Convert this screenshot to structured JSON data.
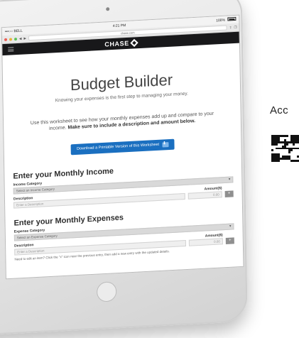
{
  "caption": "Acc",
  "status_bar": {
    "carrier": "•••○○ BELL",
    "time": "4:21 PM",
    "battery": "100%"
  },
  "browser": {
    "url": "chase.com"
  },
  "header": {
    "brand": "CHASE"
  },
  "page": {
    "title": "Budget Builder",
    "tagline": "Knowing your expenses is the first step to managing your money.",
    "intro_plain": "Use this worksheet to see how your monthly expenses add up and compare to your income.",
    "intro_bold": "Make sure to include a description and amount below.",
    "download_button": "Download a Printable Version of this Worksheet"
  },
  "income": {
    "heading": "Enter your Monthly Income",
    "category_label": "Income Category",
    "category_placeholder": "Select an Income Category",
    "amount_label": "Amount($)",
    "amount_placeholder": "0.00",
    "add_label": "+",
    "description_label": "Description",
    "description_placeholder": "Enter a Description"
  },
  "expenses": {
    "heading": "Enter your Monthly Expenses",
    "category_label": "Expense Category",
    "category_placeholder": "Select an Expense Category",
    "amount_label": "Amount($)",
    "amount_placeholder": "0.00",
    "add_label": "+",
    "description_label": "Description",
    "description_placeholder": "Enter a Description",
    "help_text": "Need to edit an item? Click the \"x\" icon near the previous entry, then add a new entry with the updated details."
  },
  "colors": {
    "header_bg": "#18181a",
    "button_blue": "#1a6fc0"
  }
}
